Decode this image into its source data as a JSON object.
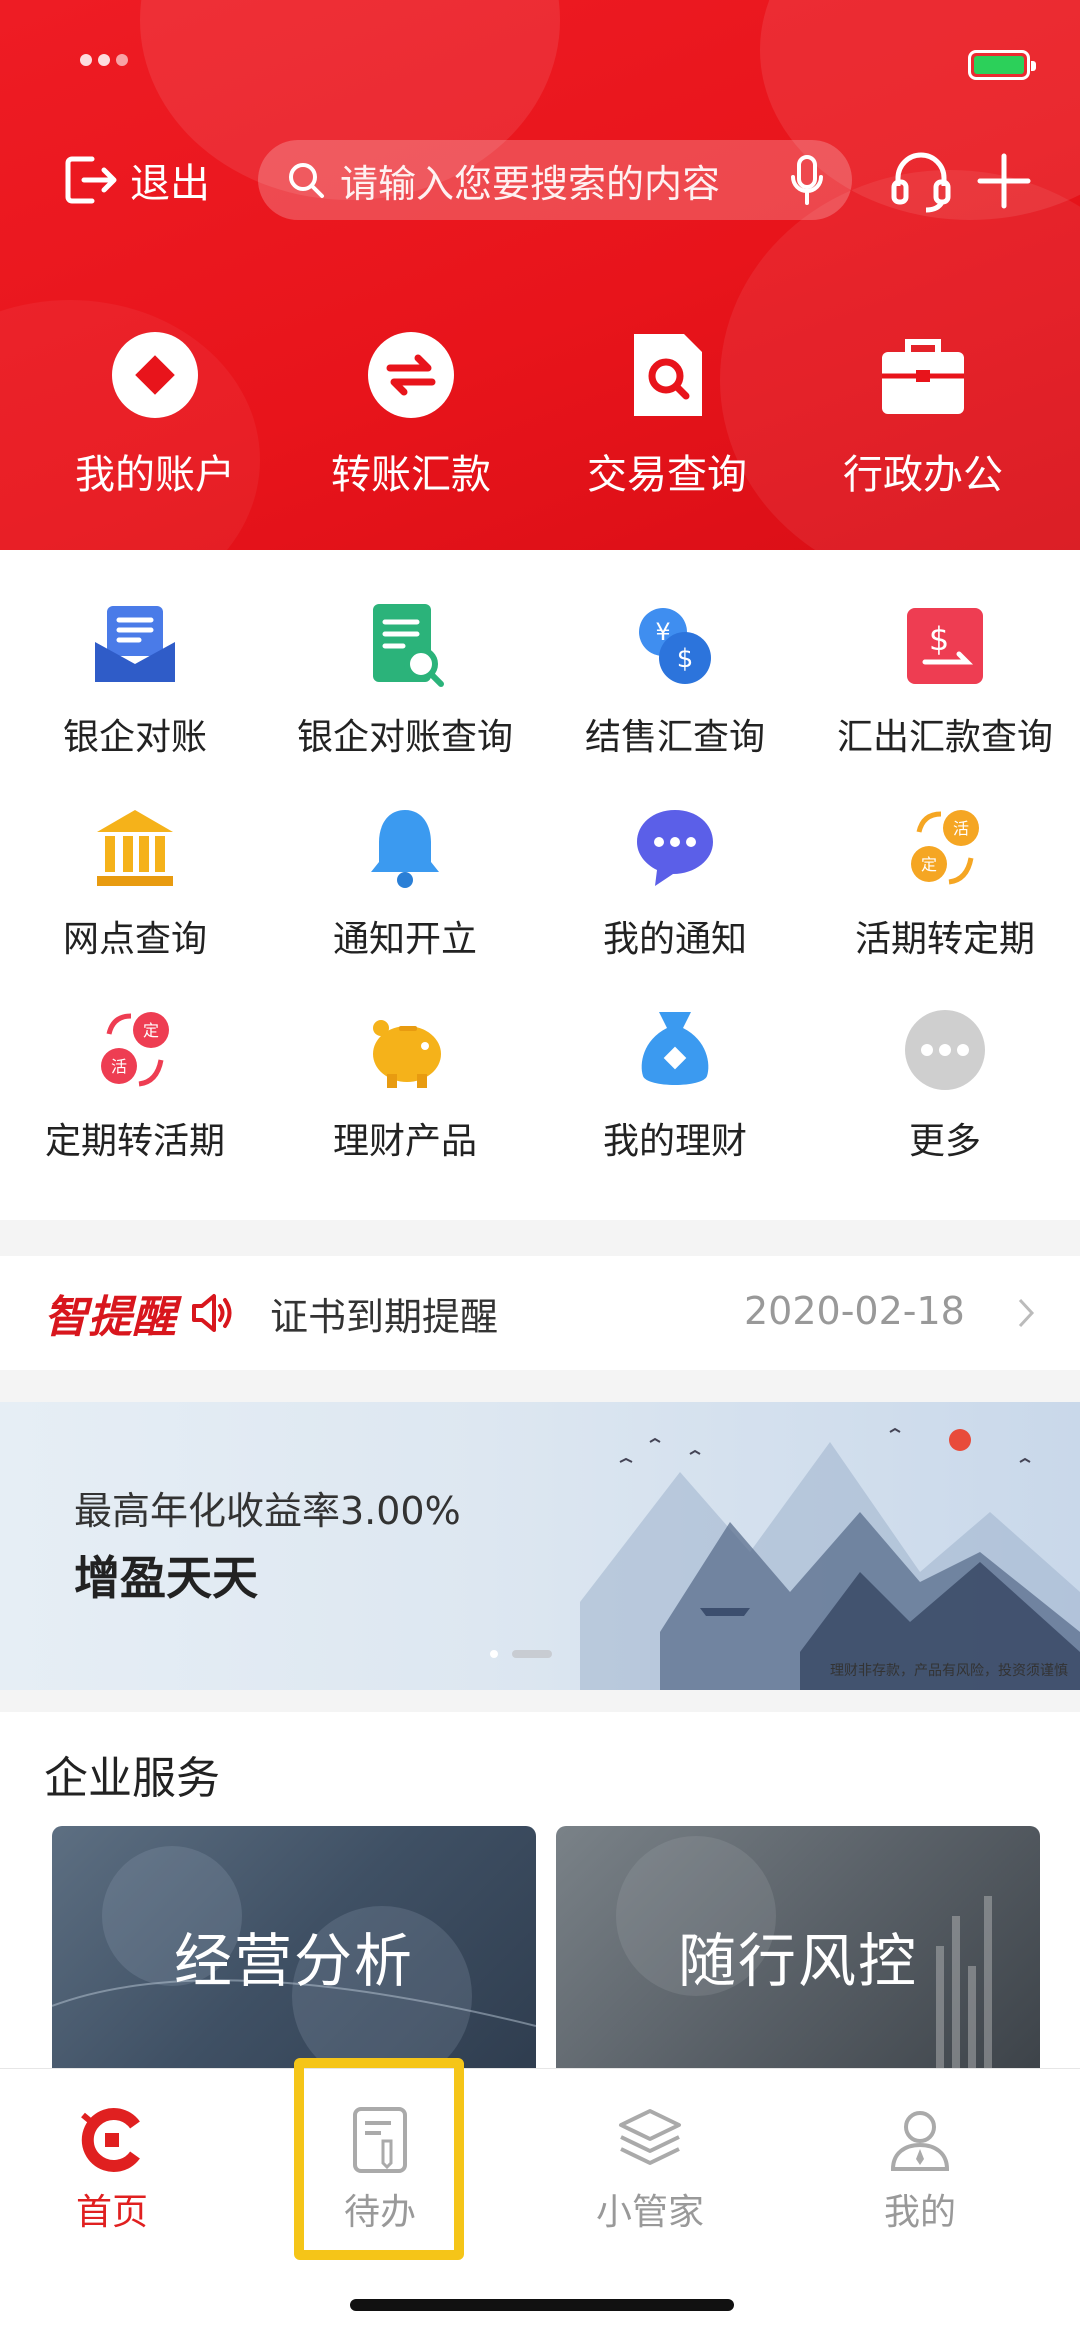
{
  "header": {
    "exit_label": "退出",
    "search_placeholder": "请输入您要搜索的内容",
    "quick_actions": [
      {
        "label": "我的账户",
        "icon": "account-icon"
      },
      {
        "label": "转账汇款",
        "icon": "transfer-icon"
      },
      {
        "label": "交易查询",
        "icon": "transaction-query-icon"
      },
      {
        "label": "行政办公",
        "icon": "briefcase-icon"
      }
    ]
  },
  "grid": {
    "items": [
      {
        "label": "银企对账",
        "icon": "bank-reconcile-icon"
      },
      {
        "label": "银企对账查询",
        "icon": "reconcile-query-icon"
      },
      {
        "label": "结售汇查询",
        "icon": "fx-query-icon"
      },
      {
        "label": "汇出汇款查询",
        "icon": "outward-remit-icon"
      },
      {
        "label": "网点查询",
        "icon": "branch-icon"
      },
      {
        "label": "通知开立",
        "icon": "bell-icon"
      },
      {
        "label": "我的通知",
        "icon": "chat-icon"
      },
      {
        "label": "活期转定期",
        "icon": "demand-to-fixed-icon"
      },
      {
        "label": "定期转活期",
        "icon": "fixed-to-demand-icon"
      },
      {
        "label": "理财产品",
        "icon": "piggy-bank-icon"
      },
      {
        "label": "我的理财",
        "icon": "money-bag-icon"
      },
      {
        "label": "更多",
        "icon": "more-icon"
      }
    ]
  },
  "reminder": {
    "brand": "智提醒",
    "text": "证书到期提醒",
    "date": "2020-02-18"
  },
  "banner": {
    "line1": "最高年化收益率3.00%",
    "line2": "增盈天天",
    "note": "理财非存款，产品有风险，投资须谨慎"
  },
  "services": {
    "title": "企业服务",
    "cards": [
      "经营分析",
      "随行风控"
    ]
  },
  "tabbar": {
    "tabs": [
      {
        "label": "首页",
        "icon": "home-icon",
        "active": true
      },
      {
        "label": "待办",
        "icon": "todo-icon",
        "active": false
      },
      {
        "label": "小管家",
        "icon": "layers-icon",
        "active": false
      },
      {
        "label": "我的",
        "icon": "profile-icon",
        "active": false
      }
    ]
  },
  "colors": {
    "brand_red": "#e8141b",
    "highlight": "#f5c518"
  }
}
